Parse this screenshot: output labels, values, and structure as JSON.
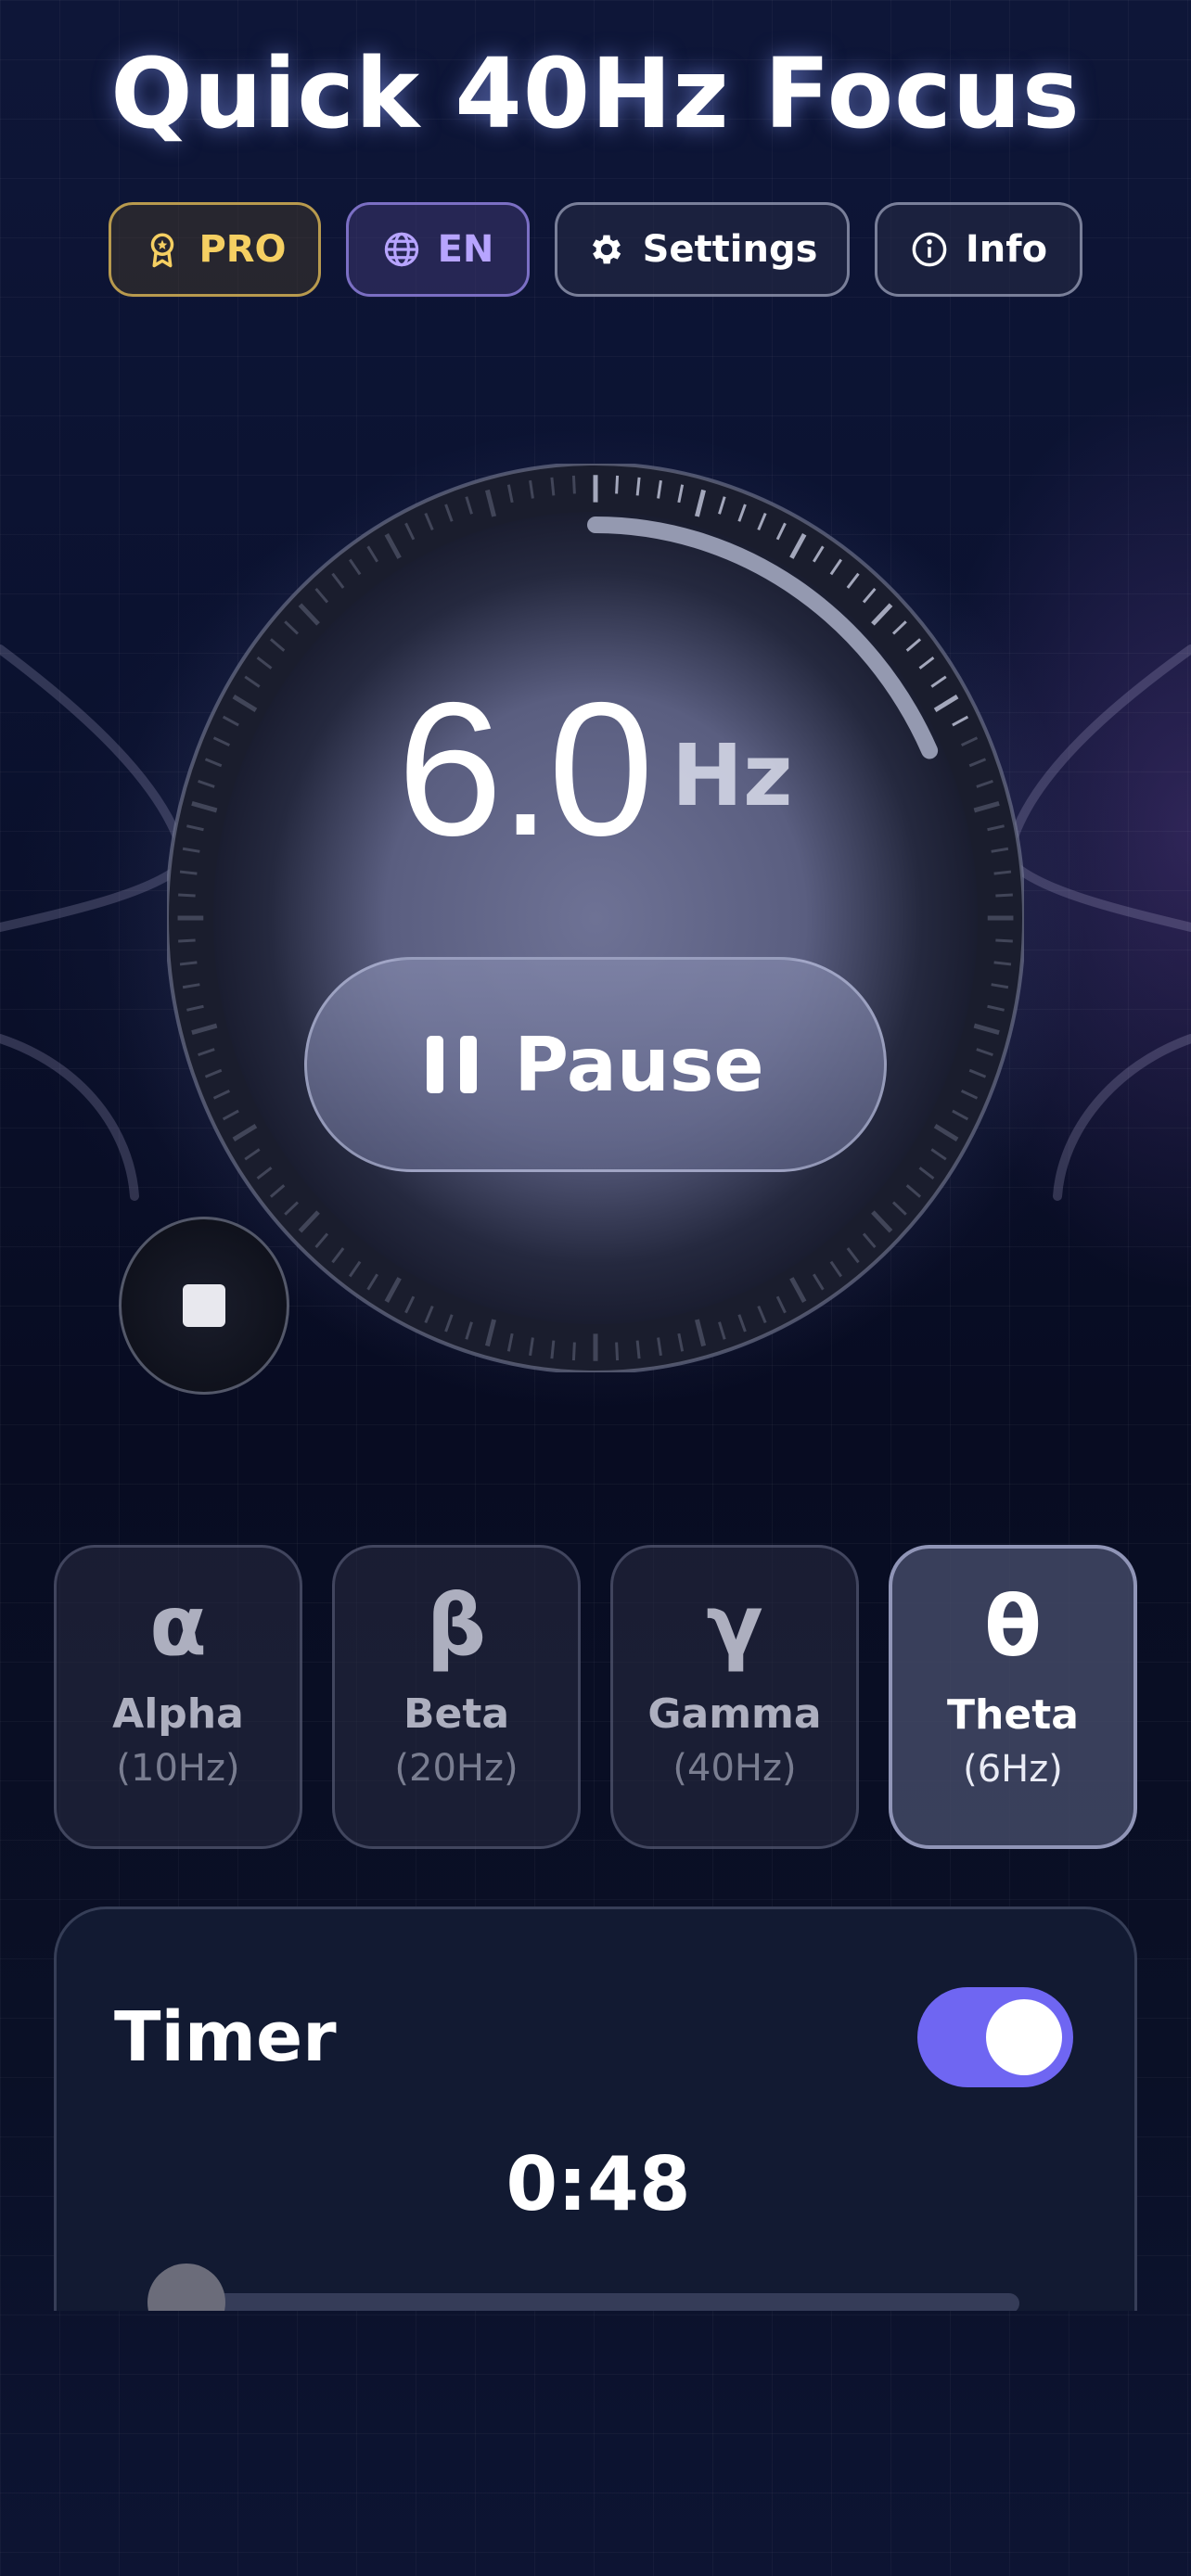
{
  "header": {
    "title": "Quick 40Hz Focus"
  },
  "toolbar": {
    "pro_label": "PRO",
    "language_label": "EN",
    "settings_label": "Settings",
    "info_label": "Info"
  },
  "dial": {
    "frequency_value": "6.0",
    "frequency_unit": "Hz",
    "pause_label": "Pause",
    "progress_fraction": 0.18
  },
  "wave_presets": [
    {
      "symbol": "α",
      "name": "Alpha",
      "hz": "(10Hz)",
      "selected": false
    },
    {
      "symbol": "β",
      "name": "Beta",
      "hz": "(20Hz)",
      "selected": false
    },
    {
      "symbol": "γ",
      "name": "Gamma",
      "hz": "(40Hz)",
      "selected": false
    },
    {
      "symbol": "θ",
      "name": "Theta",
      "hz": "(6Hz)",
      "selected": true
    }
  ],
  "timer": {
    "label": "Timer",
    "enabled": true,
    "value": "0:48",
    "slider_fraction": 0.0
  },
  "colors": {
    "accent": "#6f66f2",
    "pro_gold": "#f5cf62",
    "language_purple": "#b7a4ff"
  },
  "icons": {
    "pro": "award-badge-icon",
    "language": "globe-icon",
    "settings": "gear-icon",
    "info": "info-circle-icon",
    "pause": "pause-icon",
    "stop": "stop-icon"
  }
}
